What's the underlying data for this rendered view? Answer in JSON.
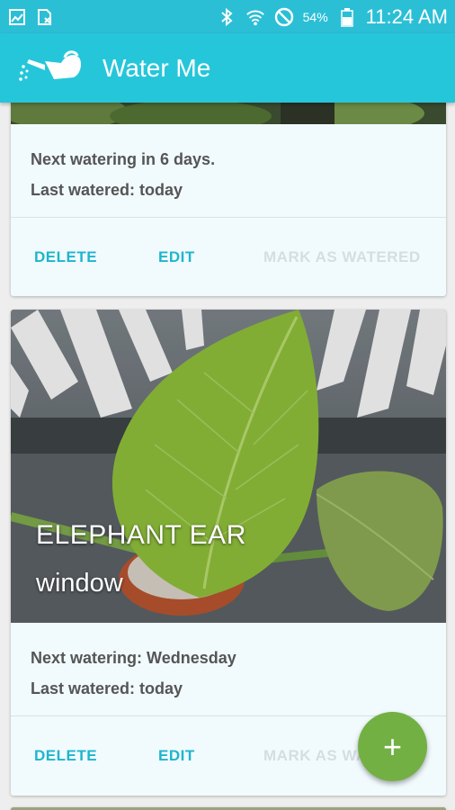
{
  "status_bar": {
    "battery_percent": "54%",
    "time": "11:24 AM",
    "icons": [
      "gallery-notification-icon",
      "sim-notification-icon",
      "bluetooth-icon",
      "wifi-icon",
      "do-not-disturb-icon",
      "battery-icon"
    ]
  },
  "app_bar": {
    "title": "Water Me",
    "color": "#26c6da"
  },
  "cards": [
    {
      "next_watering": "Next watering in 6 days.",
      "last_watered": "Last watered: today",
      "actions": {
        "delete": "DELETE",
        "edit": "EDIT",
        "mark": "MARK AS WATERED"
      }
    },
    {
      "name": "ELEPHANT EAR",
      "location": "window",
      "next_watering": "Next watering: Wednesday",
      "last_watered": "Last watered: today",
      "actions": {
        "delete": "DELETE",
        "edit": "EDIT",
        "mark": "MARK AS WATERED"
      }
    }
  ],
  "fab": {
    "label": "+",
    "color": "#72b043"
  }
}
